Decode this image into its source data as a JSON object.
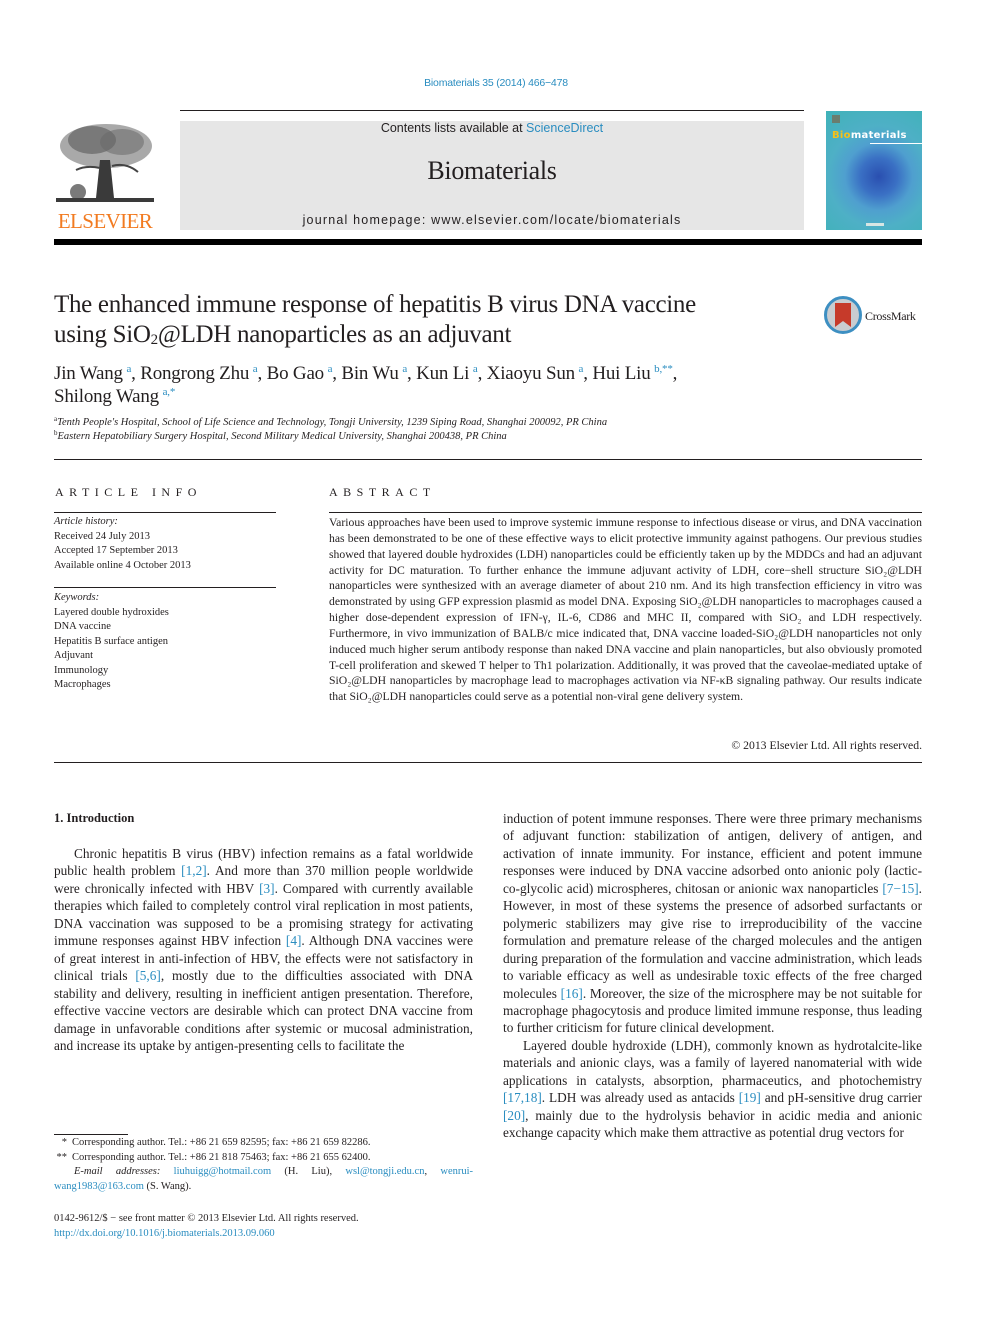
{
  "header": {
    "citation": "Biomaterials 35 (2014) 466−478",
    "contents_prefix": "Contents lists available at ",
    "contents_link": "ScienceDirect",
    "journal_name": "Biomaterials",
    "homepage": "journal homepage: www.elsevier.com/locate/biomaterials",
    "publisher_logo_text": "ELSEVIER",
    "cover_title_highlight": "Bio",
    "cover_title_rest": "materials",
    "brand_color": "#f27b21",
    "link_color": "#2a8dc0"
  },
  "article": {
    "title_line1": "The enhanced immune response of hepatitis B virus DNA vaccine",
    "title_line2_pre": "using SiO",
    "title_line2_sub": "2",
    "title_line2_post": "@LDH nanoparticles as an adjuvant",
    "crossmark_label": "CrossMark",
    "authors": [
      {
        "name": "Jin Wang",
        "sup": "a",
        "sep": ", "
      },
      {
        "name": "Rongrong Zhu",
        "sup": "a",
        "sep": ", "
      },
      {
        "name": "Bo Gao",
        "sup": "a",
        "sep": ", "
      },
      {
        "name": "Bin Wu",
        "sup": "a",
        "sep": ", "
      },
      {
        "name": "Kun Li",
        "sup": "a",
        "sep": ", "
      },
      {
        "name": "Xiaoyu Sun",
        "sup": "a",
        "sep": ", "
      },
      {
        "name": "Hui Liu",
        "sup": "b,**",
        "sep": ","
      },
      {
        "name": "Shilong Wang",
        "sup": "a,*",
        "sep": ""
      }
    ],
    "affiliations": [
      {
        "mark": "a",
        "text": "Tenth People's Hospital, School of Life Science and Technology, Tongji University, 1239 Siping Road, Shanghai 200092, PR China"
      },
      {
        "mark": "b",
        "text": "Eastern Hepatobiliary Surgery Hospital, Second Military Medical University, Shanghai 200438, PR China"
      }
    ]
  },
  "article_info": {
    "heading": "ARTICLE INFO",
    "history_label": "Article history:",
    "history": [
      "Received 24 July 2013",
      "Accepted 17 September 2013",
      "Available online 4 October 2013"
    ],
    "keywords_label": "Keywords:",
    "keywords": [
      "Layered double hydroxides",
      "DNA vaccine",
      "Hepatitis B surface antigen",
      "Adjuvant",
      "Immunology",
      "Macrophages"
    ]
  },
  "abstract": {
    "heading": "ABSTRACT",
    "p1": "Various approaches have been used to improve systemic immune response to infectious disease or virus, and DNA vaccination has been demonstrated to be one of these effective ways to elicit protective immunity against pathogens. Our previous studies showed that layered double hydroxides (LDH) nanoparticles could be efficiently taken up by the MDDCs and had an adjuvant activity for DC maturation. To further enhance the immune adjuvant activity of LDH, core−shell structure SiO₂@LDH nanoparticles were synthesized with an average diameter of about 210 nm. And its high transfection efficiency in vitro was demonstrated by using GFP expression plasmid as model DNA. Exposing SiO₂@LDH nanoparticles to macrophages caused a higher dose-dependent expression of IFN-γ, IL-6, CD86 and MHC II, compared with SiO₂ and LDH respectively. Furthermore, in vivo immunization of BALB/c mice indicated that, DNA vaccine loaded-SiO₂@LDH nanoparticles not only induced much higher serum antibody response than naked DNA vaccine and plain nanoparticles, but also obviously promoted T-cell proliferation and skewed T helper to Th1 polarization. Additionally, it was proved that the caveolae-mediated uptake of SiO₂@LDH nanoparticles by macrophage lead to macrophages activation via NF-κB signaling pathway. Our results indicate that SiO₂@LDH nanoparticles could serve as a potential non-viral gene delivery system.",
    "copyright": "© 2013 Elsevier Ltd. All rights reserved."
  },
  "body": {
    "section_heading": "1.  Introduction",
    "left_para": [
      {
        "t": "Chronic hepatitis B virus (HBV) infection remains as a fatal worldwide public health problem "
      },
      {
        "ref": "[1,2]"
      },
      {
        "t": ". And more than 370 million people worldwide were chronically infected with HBV "
      },
      {
        "ref": "[3]"
      },
      {
        "t": ". Compared with currently available therapies which failed to completely control viral replication in most patients, DNA vaccination was supposed to be a promising strategy for activating immune responses against HBV infection "
      },
      {
        "ref": "[4]"
      },
      {
        "t": ". Although DNA vaccines were of great interest in anti-infection of HBV, the effects were not satisfactory in clinical trials "
      },
      {
        "ref": "[5,6]"
      },
      {
        "t": ", mostly due to the difficulties associated with DNA stability and delivery, resulting in inefficient antigen presentation. Therefore, effective vaccine vectors are desirable which can protect DNA vaccine from damage in unfavorable conditions after systemic or mucosal administration, and increase its uptake by antigen-presenting cells to facilitate the"
      }
    ],
    "right_para1": [
      {
        "t": "induction of potent immune responses. There were three primary mechanisms of adjuvant function: stabilization of antigen, delivery of antigen, and activation of innate immunity. For instance, efficient and potent immune responses were induced by DNA vaccine adsorbed onto anionic poly (lactic-co-glycolic acid) microspheres, chitosan or anionic wax nanoparticles "
      },
      {
        "ref": "[7−15]"
      },
      {
        "t": ". However, in most of these systems the presence of adsorbed surfactants or polymeric stabilizers may give rise to irreproducibility of the vaccine formulation and premature release of the charged molecules and the antigen during preparation of the formulation and vaccine administration, which leads to variable efficacy as well as undesirable toxic effects of the free charged molecules "
      },
      {
        "ref": "[16]"
      },
      {
        "t": ". Moreover, the size of the microsphere may be not suitable for macrophage phagocytosis and produce limited immune response, thus leading to further criticism for future clinical development."
      }
    ],
    "right_para2": [
      {
        "t": "Layered double hydroxide (LDH), commonly known as hydrotalcite-like materials and anionic clays, was a family of layered nanomaterial with wide applications in catalysts, absorption, pharmaceutics, and photochemistry "
      },
      {
        "ref": "[17,18]"
      },
      {
        "t": ". LDH was already used as antacids "
      },
      {
        "ref": "[19]"
      },
      {
        "t": " and pH-sensitive drug carrier "
      },
      {
        "ref": "[20]"
      },
      {
        "t": ", mainly due to the hydrolysis behavior in acidic media and anionic exchange capacity which make them attractive as potential drug vectors for"
      }
    ]
  },
  "footnotes": {
    "fn1_mark": "*",
    "fn1_text": "Corresponding author. Tel.: +86 21 659 82595; fax: +86 21 659 82286.",
    "fn2_mark": "**",
    "fn2_text": "Corresponding author. Tel.: +86 21 818 75463; fax: +86 21 655 62400.",
    "email_label": "E-mail addresses:",
    "email1": "liuhuigg@hotmail.com",
    "email1_owner": " (H. Liu), ",
    "email2": "wsl@tongji.edu.cn",
    "email_sep": ", ",
    "email3": "wenrui-wang1983@163.com",
    "email3_owner": " (S. Wang).",
    "front_matter": "0142-9612/$ − see front matter © 2013 Elsevier Ltd. All rights reserved.",
    "doi": "http://dx.doi.org/10.1016/j.biomaterials.2013.09.060"
  }
}
